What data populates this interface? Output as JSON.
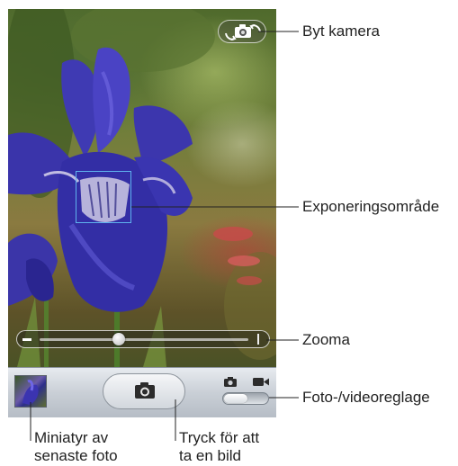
{
  "camera_ui": {
    "toolbar": {
      "photo_mode_icon": "camera-icon",
      "video_mode_icon": "video-camera-icon",
      "shutter_icon": "camera-icon",
      "switch_camera_icon": "switch-camera-icon"
    },
    "zoom": {
      "level_fraction": 0.38
    },
    "mode_switch": {
      "selected": "photo"
    },
    "colors": {
      "focus_box": "#5fb2ee",
      "toolbar": "#c9cfd6"
    }
  },
  "callouts": {
    "switch_camera": "Byt kamera",
    "exposure_area": "Exponeringsområde",
    "zoom": "Zooma",
    "photo_video_switch": "Foto-/videoreglage",
    "thumbnail_line1": "Miniatyr av",
    "thumbnail_line2": "senaste foto",
    "shutter_line1": "Tryck för att",
    "shutter_line2": "ta en bild"
  }
}
